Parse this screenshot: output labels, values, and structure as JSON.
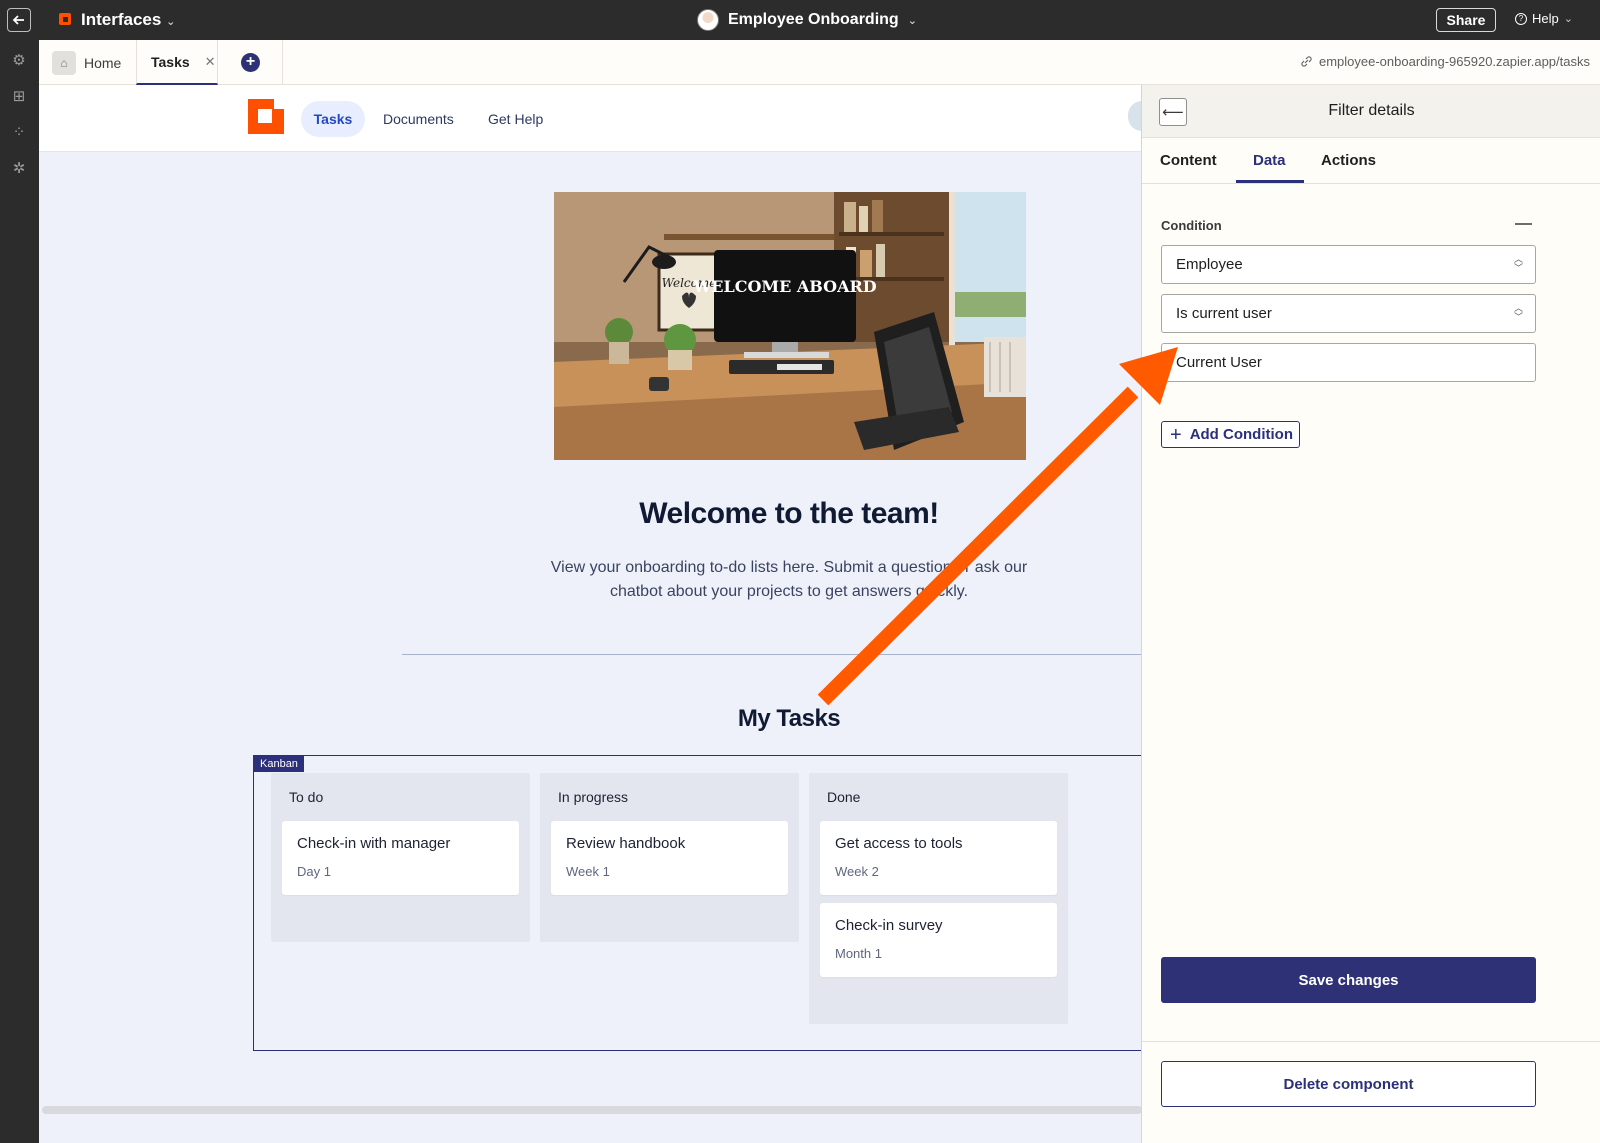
{
  "topbar": {
    "app_name": "Interfaces",
    "project_name": "Employee Onboarding",
    "share_label": "Share",
    "help_label": "Help"
  },
  "tabs": {
    "home_label": "Home",
    "tasks_label": "Tasks",
    "url": "employee-onboarding-965920.zapier.app/tasks"
  },
  "site_nav": {
    "items": [
      "Tasks",
      "Documents",
      "Get Help"
    ]
  },
  "hero": {
    "image_text": "WELCOME ABOARD",
    "frame_text": "Welcome"
  },
  "content": {
    "heading": "Welcome to the team!",
    "intro": "View your onboarding to-do lists here. Submit a question or ask our chatbot about your projects to get answers quickly.",
    "tasks_heading": "My Tasks"
  },
  "kanban": {
    "tag": "Kanban",
    "columns": [
      {
        "title": "To do",
        "cards": [
          {
            "title": "Check-in with manager",
            "sub": "Day 1"
          }
        ]
      },
      {
        "title": "In progress",
        "cards": [
          {
            "title": "Review handbook",
            "sub": "Week 1"
          }
        ]
      },
      {
        "title": "Done",
        "cards": [
          {
            "title": "Get access to tools",
            "sub": "Week 2"
          },
          {
            "title": "Check-in survey",
            "sub": "Month 1"
          }
        ]
      }
    ]
  },
  "panel": {
    "title": "Filter details",
    "tabs": [
      "Content",
      "Data",
      "Actions"
    ],
    "active_tab": "Data",
    "condition_label": "Condition",
    "field_value": "Employee",
    "operator_value": "Is current user",
    "compare_value": "Current User",
    "add_condition_label": "Add Condition",
    "save_label": "Save changes",
    "delete_label": "Delete component"
  },
  "colors": {
    "accent": "#2c2f7a",
    "brand": "#ff4f00",
    "annotation_arrow": "#ff5a00"
  }
}
